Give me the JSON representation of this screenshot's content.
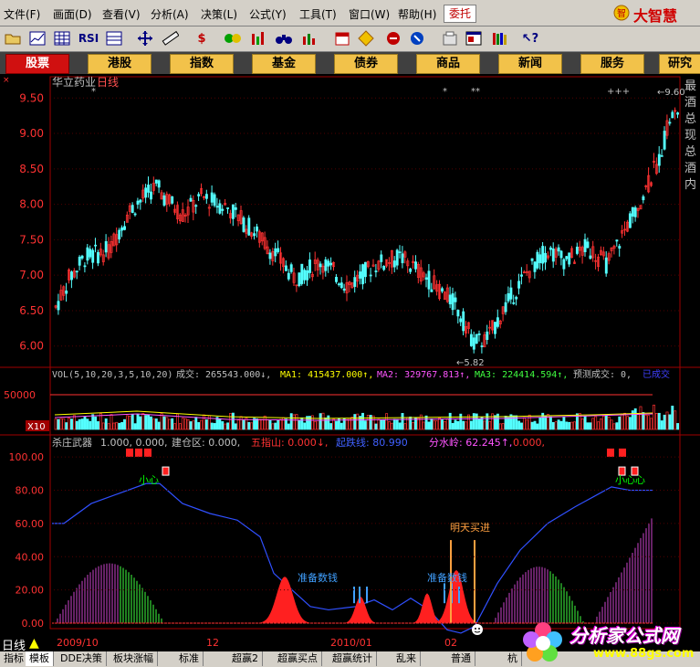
{
  "menu": {
    "items": [
      "文件(F)",
      "画面(D)",
      "查看(V)",
      "分析(A)",
      "决策(L)",
      "公式(Y)",
      "工具(T)",
      "窗口(W)",
      "帮助(H)"
    ],
    "entrust": "委托",
    "brand": "大智慧"
  },
  "toolbar": {
    "icons": [
      "open-folder-icon",
      "chart-icon",
      "table-icon",
      "rsi-icon",
      "grid-icon",
      "move-icon",
      "ruler-icon",
      "dollar-icon",
      "bars-icon",
      "columns-icon",
      "binoculars-icon",
      "finance-icon",
      "calendar-icon",
      "diamond-icon",
      "link-icon",
      "phone-icon",
      "doc-icon",
      "window-icon",
      "books-icon",
      "help-cursor-icon"
    ],
    "rsi_label": "RSI"
  },
  "nav": {
    "tabs": [
      "股票",
      "港股",
      "指数",
      "基金",
      "债券",
      "商品",
      "新闻",
      "服务",
      "研究"
    ]
  },
  "price_panel": {
    "title": "华立药业",
    "period": "日线",
    "y_ticks": [
      "9.50",
      "9.00",
      "8.50",
      "8.00",
      "7.50",
      "7.00",
      "6.50",
      "6.00"
    ],
    "high_label": "9.60",
    "low_label": "5.82",
    "right_text": [
      "最",
      "酒",
      "总",
      "现",
      "总",
      "酒",
      "内"
    ]
  },
  "volume_panel": {
    "label": "VOL(5,10,20,3,5,10,20)",
    "cj": "成交: 265543.000↓,",
    "ma1": "MA1: 415437.000↑,",
    "ma2": "MA2: 329767.813↑,",
    "ma3": "MA3: 224414.594↑,",
    "forecast": "预测成交: 0,",
    "done": "已成交",
    "y_tick": "50000",
    "x10": "X10"
  },
  "indicator_panel": {
    "name": "杀庄武器",
    "values": "1.000, 0.000,",
    "jcq": "建仓区: 0.000,",
    "wzs": "五指山: 0.000↓,",
    "qmx": "起跌线: 80.990",
    "fsl": "分水岭: 62.245↑,",
    "tail": "0.000,",
    "y_ticks": [
      "100.00",
      "80.00",
      "60.00",
      "40.00",
      "20.00",
      "0.00"
    ],
    "labels": {
      "xiaoxin_left": "小心",
      "xiaoxin_right": "小心心",
      "zhunbei1": "准备数钱",
      "zhunbei2": "准备数钱",
      "mingtian": "明天买进"
    }
  },
  "x_axis": {
    "labels": [
      "2009/10",
      "12",
      "2010/01",
      "02"
    ],
    "period_label": "日线"
  },
  "bottom_tabs": [
    "指标",
    "模板",
    "DDE决策",
    "板块涨幅",
    "标准",
    "超赢2",
    "超赢买点",
    "超赢统计",
    "乱来",
    "普通",
    "杭"
  ],
  "watermark": {
    "text": "分析家公式网",
    "url": "www.88gs.com"
  },
  "colors": {
    "up": "#ff3232",
    "down": "#54ffff",
    "grid": "#a00000",
    "text": "#c0c0c0"
  }
}
